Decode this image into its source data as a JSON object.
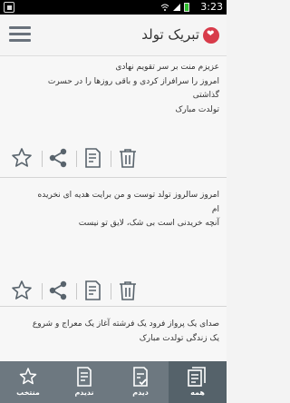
{
  "statusbar": {
    "time": "3:23"
  },
  "appbar": {
    "title": "تبریک تولد"
  },
  "cards": [
    {
      "lines": [
        "عزیزم منت بر سر تقویم نهادی",
        "امروز را سرافراز کردی و باقی روزها را در حسرت",
        "گذاشتی",
        "تولدت مبارک"
      ]
    },
    {
      "lines": [
        "امروز سالروز تولد توست و من برایت هدیه ای نخریده",
        "ام",
        "آنچه خریدنی است بی شک، لایق تو نیست"
      ]
    },
    {
      "lines": [
        "صدای یک پرواز فرود یک فرشته آغاز یک معراج و شروع",
        "یک زندگی تولدت مبارک"
      ]
    }
  ],
  "bottom_nav": {
    "tabs": [
      {
        "label": "منتخب"
      },
      {
        "label": "ندیدم"
      },
      {
        "label": "دیدم"
      },
      {
        "label": "همه"
      }
    ]
  }
}
